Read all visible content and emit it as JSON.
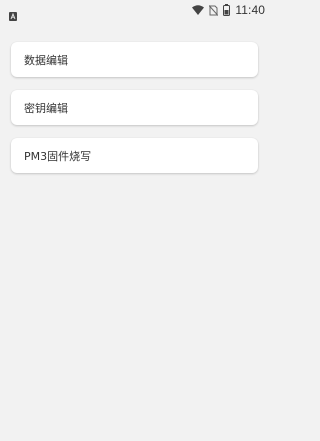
{
  "status_bar": {
    "time": "11:40",
    "icons": [
      "notification-a-icon",
      "wifi-icon",
      "no-sim-icon",
      "battery-icon"
    ]
  },
  "menu": {
    "items": [
      {
        "label": "数据编辑"
      },
      {
        "label": "密钥编辑"
      },
      {
        "label": "PM3固件烧写"
      }
    ]
  },
  "colors": {
    "background": "#f2f2f2",
    "card": "#ffffff",
    "text": "#333333"
  }
}
